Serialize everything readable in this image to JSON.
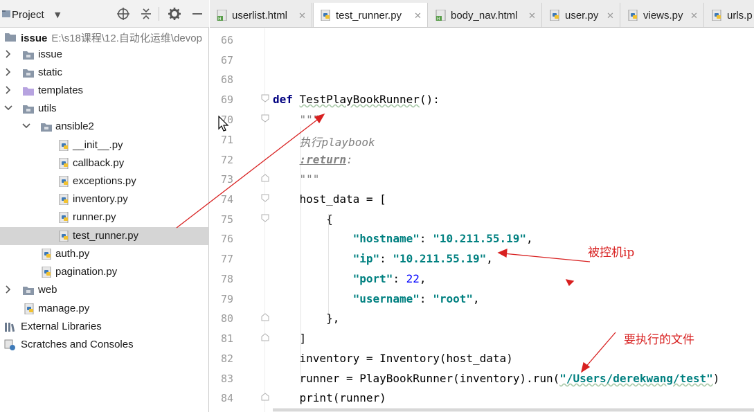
{
  "project_panel": {
    "title": "Project",
    "tree": [
      {
        "label": "issue",
        "path": "E:\\s18课程\\12.自动化运维\\devop",
        "kind": "project-root",
        "expanded": true,
        "bold": true
      },
      {
        "label": "issue",
        "kind": "folder",
        "expanded": false
      },
      {
        "label": "static",
        "kind": "folder",
        "expanded": false
      },
      {
        "label": "templates",
        "kind": "folder-purple",
        "expanded": false
      },
      {
        "label": "utils",
        "kind": "folder",
        "expanded": true
      },
      {
        "label": "ansible2",
        "kind": "folder",
        "expanded": true
      },
      {
        "label": "__init__.py",
        "kind": "python-file"
      },
      {
        "label": "callback.py",
        "kind": "python-file"
      },
      {
        "label": "exceptions.py",
        "kind": "python-file"
      },
      {
        "label": "inventory.py",
        "kind": "python-file"
      },
      {
        "label": "runner.py",
        "kind": "python-file"
      },
      {
        "label": "test_runner.py",
        "kind": "python-file",
        "selected": true
      },
      {
        "label": "auth.py",
        "kind": "python-file"
      },
      {
        "label": "pagination.py",
        "kind": "python-file"
      },
      {
        "label": "web",
        "kind": "folder",
        "expanded": false
      },
      {
        "label": "manage.py",
        "kind": "python-file"
      },
      {
        "label": "External Libraries",
        "kind": "libraries"
      },
      {
        "label": "Scratches and Consoles",
        "kind": "scratches"
      }
    ]
  },
  "editor": {
    "tabs": [
      {
        "label": "userlist.html",
        "icon": "html-file-icon",
        "active": false
      },
      {
        "label": "test_runner.py",
        "icon": "python-file-icon",
        "active": true
      },
      {
        "label": "body_nav.html",
        "icon": "html-file-icon",
        "active": false
      },
      {
        "label": "user.py",
        "icon": "python-file-icon",
        "active": false
      },
      {
        "label": "views.py",
        "icon": "python-file-icon",
        "active": false
      },
      {
        "label": "urls.p",
        "icon": "python-file-icon",
        "active": false
      }
    ],
    "line_numbers": [
      "66",
      "67",
      "68",
      "69",
      "70",
      "71",
      "72",
      "73",
      "74",
      "75",
      "76",
      "77",
      "78",
      "79",
      "80",
      "81",
      "82",
      "83",
      "84"
    ],
    "code": {
      "def_kw": "def",
      "func_name": "TestPlayBookRunner",
      "func_tail": "():",
      "doc_quote_open": "\"\"\"",
      "doc_text": "执行playbook",
      "doc_return": ":return",
      "doc_return_tail": ":",
      "doc_quote_close": "\"\"\"",
      "host_data_line": "host_data = [",
      "brace_open": "{",
      "k_hostname": "\"hostname\"",
      "v_hostname": "\"10.211.55.19\"",
      "k_ip": "\"ip\"",
      "v_ip": "\"10.211.55.19\"",
      "k_port": "\"port\"",
      "v_port": "22",
      "k_username": "\"username\"",
      "v_username": "\"root\"",
      "brace_close": "},",
      "bracket_close": "]",
      "inventory_line": "inventory = Inventory(host_data)",
      "runner_prefix": "runner = PlayBookRunner(inventory).run(",
      "runner_path": "\"/Users/derekwang/test\"",
      "runner_suffix": ")",
      "print_line": "print(runner)"
    }
  },
  "annotations": {
    "controlled_host_ip": "被控机ip",
    "file_to_execute": "要执行的文件"
  },
  "colors": {
    "annotation_red": "#d82020",
    "keyword_navy": "#000080",
    "string_teal": "#008080",
    "selection_gray": "#d5d5d5"
  }
}
